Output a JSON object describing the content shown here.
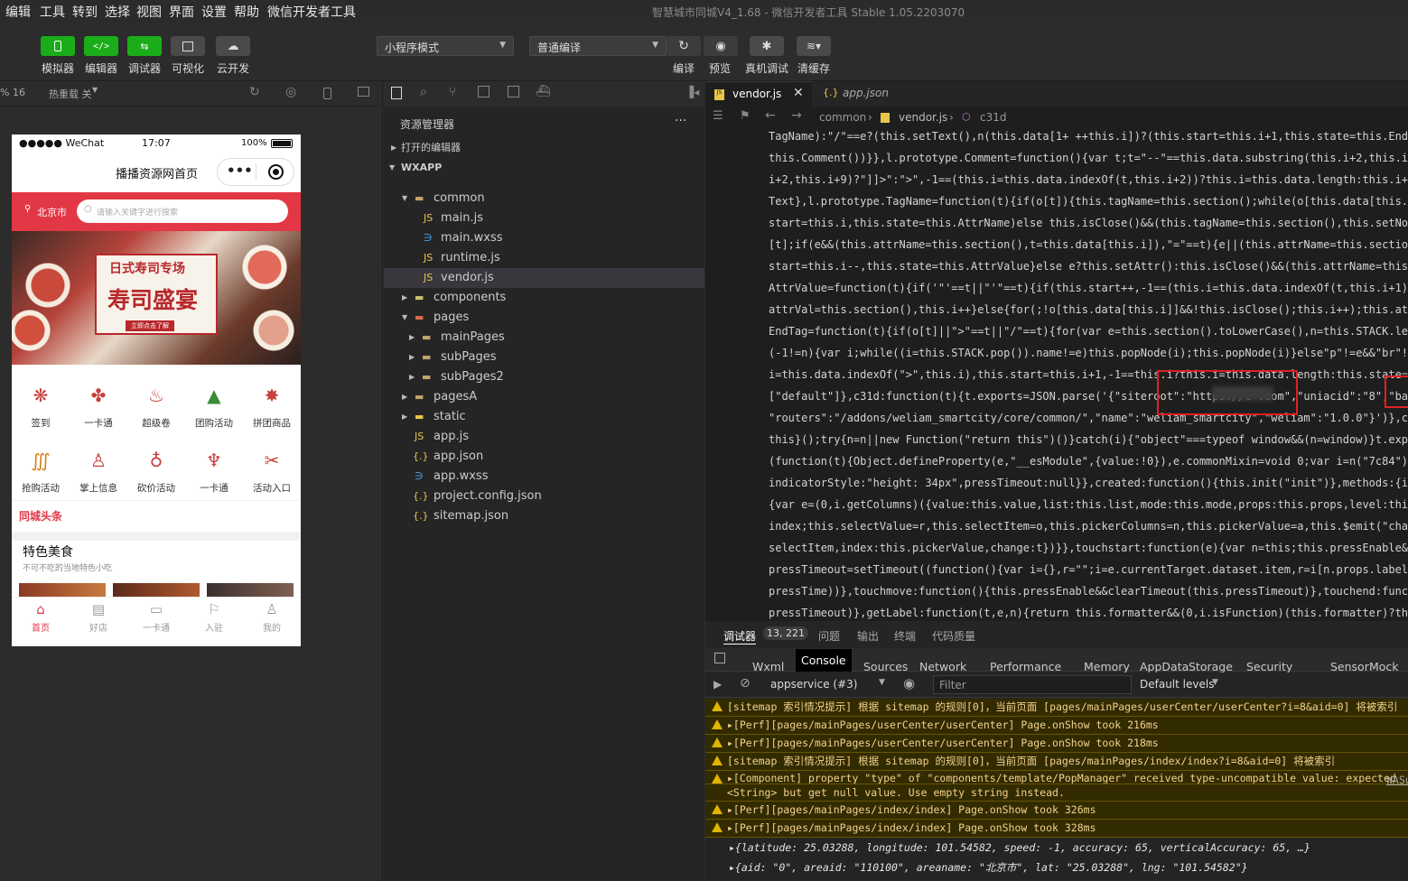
{
  "menu": [
    "编辑",
    "工具",
    "转到",
    "选择",
    "视图",
    "界面",
    "设置",
    "帮助",
    "微信开发者工具"
  ],
  "window_title": "智慧城市同城V4_1.68 - 微信开发者工具 Stable 1.05.2203070",
  "toolbar": {
    "simulator": "模拟器",
    "editor": "编辑器",
    "debugger": "调试器",
    "visual": "可视化",
    "cloud": "云开发",
    "mode": "小程序模式",
    "compile_mode": "普通编译",
    "compile": "编译",
    "preview": "预览",
    "real_debug": "真机调试",
    "clear_cache": "清缓存"
  },
  "simbar": {
    "zoom": "% 16",
    "hotreload": "热重载 关"
  },
  "phone": {
    "carrier": "●●●●● WeChat",
    "time": "17:07",
    "battery": "100%",
    "nav_title": "播播资源网首页",
    "city": "北京市",
    "search_placeholder": "请输入关键字进行搜索",
    "banner_tag": "日式寿司专场",
    "banner_title": "寿司盛宴",
    "banner_btn": "立即点击了解",
    "grid": [
      "签到",
      "一卡通",
      "超级卷",
      "团购活动",
      "拼团商品",
      "抢购活动",
      "掌上信息",
      "砍价活动",
      "一卡通",
      "活动入口"
    ],
    "headline": "同城头条",
    "section_title": "特色美食",
    "section_sub": "不可不吃的当地特色小吃",
    "tabbar": [
      "首页",
      "好店",
      "一卡通",
      "入驻",
      "我的"
    ]
  },
  "explorer": {
    "title": "资源管理器",
    "open_editors": "打开的编辑器",
    "root": "WXAPP",
    "items": [
      "common",
      "main.js",
      "main.wxss",
      "runtime.js",
      "vendor.js",
      "components",
      "pages",
      "mainPages",
      "subPages",
      "subPages2",
      "pagesA",
      "static",
      "app.js",
      "app.json",
      "app.wxss",
      "project.config.json",
      "sitemap.json"
    ]
  },
  "editor": {
    "tabs": [
      "vendor.js",
      "app.json"
    ],
    "breadcrumb": [
      "common",
      "vendor.js",
      "c31d"
    ],
    "lines": [
      "TagName):\"/\"==e?(this.setText(),n(this.data[1+ ++this.i])?(this.start=this.i+1,this.state=this.EndTag):this",
      "this.Comment())}},l.prototype.Comment=function(){var t;t=\"--\"==this.data.substring(this.i+2,this.i+4)?\"--\\x3e",
      "i+2,this.i+9)?\"]]>\":\">\",-1==(this.i=this.data.indexOf(t,this.i+2))?this.i=this.data.length:this.i+=t.length-",
      "Text},l.prototype.TagName=function(t){if(o[t]){this.tagName=this.section();while(o[this.data[this.i]])this.",
      "start=this.i,this.state=this.AttrName)else this.isClose()&&(this.tagName=this.section(),this.setNode())},l",
      "[t];if(e&&(this.attrName=this.section(),t=this.data[this.i]),\"=\"==t){e||(this.attrName=this.section());while",
      "start=this.i--,this.state=this.AttrValue}else e?this.setAttr():this.isClose()&&(this.attrName=this.section(",
      "AttrValue=function(t){if('\"'==t||\"'\"==t){if(this.start++,-1==(this.i=this.data.indexOf(t,this.i+1)))return t",
      "attrVal=this.section(),this.i++}else{for(;!o[this.data[this.i]]&&!this.isClose();this.i++);this.attrVal=thi",
      "EndTag=function(t){if(o[t]||\">\"==t||\"/\"==t){for(var e=this.section().toLowerCase(),n=this.STACK.length;n--;",
      "(-1!=n){var i;while((i=this.STACK.pop()).name!=e)this.popNode(i);this.popNode(i)}else\"p\"!=e&&\"br\"!=e||this.",
      "i=this.data.indexOf(\">\",this.i),this.start=this.i+1,-1==this.i?this.i=this.data.length:this.state=this.Text",
      "[\"default\"]},c31d:function(t){t.exports=JSON.parse('{\"siteroot\":\"https://c          .com\",\"uniacid\":\"8\",\"ba",
      "\"routers\":\"/addons/weliam_smartcity/core/common/\",\"name\":\"weliam_smartcity\",\"weliam\":\"1.0.0\"}')},c8ba:func",
      "this}();try{n=n||new Function(\"return this\")()}catch(i){\"object\"===typeof window&&(n=window)}t.exports=n},d",
      "(function(t){Object.defineProperty(e,\"__esModule\",{value:!0}),e.commonMixin=void 0;var i=n(\"7c84\"),r={data:",
      "indicatorStyle:\"height: 34px\",pressTimeout:null}},created:function(){this.init(\"init\")},methods:{init:functi",
      "{var e=(0,i.getColumns)({value:this.value,list:this.list,mode:this.mode,props:this.props,level:this.level})",
      "index;this.selectValue=r,this.selectItem=o,this.pickerColumns=n,this.pickerValue=a,this.$emit(\"change\",{val",
      "selectItem,index:this.pickerValue,change:t})}},touchstart:function(e){var n=this;this.pressEnable&&(clearTim",
      "pressTimeout=setTimeout((function(){var i={},r=\"\";i=e.currentTarget.dataset.item,r=i[n.props.label]||i,t.sho",
      "pressTime))},touchmove:function(){this.pressEnable&&clearTimeout(this.pressTimeout)},touchend:function(){thi",
      "pressTimeout)},getLabel:function(t,e,n){return this.formatter&&(0,i.isFunction)(this.formatter)?this.format"
    ]
  },
  "debug": {
    "tabs": [
      "调试器",
      "13, 221",
      "问题",
      "输出",
      "终端",
      "代码质量"
    ],
    "devtabs": [
      "Wxml",
      "Console",
      "Sources",
      "Network",
      "Performance",
      "Memory",
      "AppData",
      "Storage",
      "Security",
      "Sensor",
      "Mock"
    ],
    "context": "appservice (#3)",
    "filter_placeholder": "Filter",
    "levels": "Default levels",
    "logs": [
      "[sitemap 索引情况提示] 根据 sitemap 的规则[0]，当前页面 [pages/mainPages/userCenter/userCenter?i=8&aid=0] 将被索引",
      "▸[Perf][pages/mainPages/userCenter/userCenter] Page.onShow took 216ms",
      "▸[Perf][pages/mainPages/userCenter/userCenter] Page.onShow took 218ms",
      "[sitemap 索引情况提示] 根据 sitemap 的规则[0]，当前页面 [pages/mainPages/index/index?i=8&aid=0] 将被索引",
      "▸[Component] property \"type\" of \"components/template/PopManager\" received type-uncompatible value: expected",
      "<String> but get null value. Use empty string instead.",
      "▸[Perf][pages/mainPages/index/index] Page.onShow took 326ms",
      "▸[Perf][pages/mainPages/index/index] Page.onShow took 328ms",
      "▸{latitude: 25.03288, longitude: 101.54582, speed: -1, accuracy: 65, verticalAccuracy: 65, …}",
      "▸{aid: \"0\", areaid: \"110100\", areaname: \"北京市\", lat: \"25.03288\", lng: \"101.54582\"}"
    ],
    "wasu": "WASu"
  }
}
